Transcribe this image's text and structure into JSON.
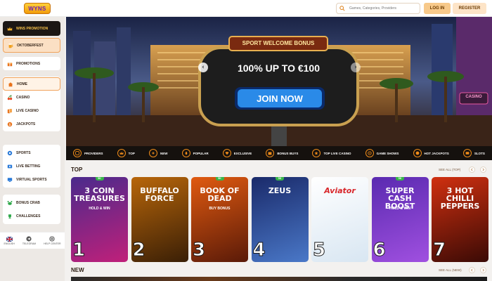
{
  "header": {
    "logo_text": "WYNS",
    "search_placeholder": "Games, Categories, Providers",
    "login_label": "LOG IN",
    "register_label": "REGISTER"
  },
  "sidebar": {
    "promo_items": [
      {
        "label": "Wins Promotion",
        "icon": "crown-icon"
      },
      {
        "label": "Oktoberfest",
        "icon": "beer-icon"
      }
    ],
    "group1": [
      {
        "label": "Promotions",
        "icon": "gift-icon"
      }
    ],
    "group2": [
      {
        "label": "Home",
        "icon": "home-icon",
        "active": true
      },
      {
        "label": "Casino",
        "icon": "cherry-icon"
      },
      {
        "label": "Live Casino",
        "icon": "cards-icon"
      },
      {
        "label": "Jackpots",
        "icon": "jackpot-icon"
      }
    ],
    "group3": [
      {
        "label": "Sports",
        "icon": "ball-icon"
      },
      {
        "label": "Live Betting",
        "icon": "live-icon"
      },
      {
        "label": "Virtual Sports",
        "icon": "monitor-icon"
      }
    ],
    "group4": [
      {
        "label": "Bonus Crab",
        "icon": "crab-icon"
      },
      {
        "label": "Challenges",
        "icon": "trophy-icon"
      }
    ],
    "bottom": [
      {
        "label": "English",
        "icon": "flag-icon"
      },
      {
        "label": "Telegram",
        "icon": "telegram-icon"
      },
      {
        "label": "Help Center",
        "icon": "help-icon"
      }
    ]
  },
  "hero": {
    "sign_title": "SPORT WELCOME BONUS",
    "offer": "100% UP TO €100",
    "cta": "JOIN NOW",
    "casino_sign": "CASINO"
  },
  "categories": [
    {
      "label": "Providers",
      "icon": "providers-icon"
    },
    {
      "label": "Top",
      "icon": "top-icon"
    },
    {
      "label": "New",
      "icon": "new-icon"
    },
    {
      "label": "Popular",
      "icon": "popular-icon"
    },
    {
      "label": "Exclusive",
      "icon": "exclusive-icon"
    },
    {
      "label": "Bonus Buys",
      "icon": "bonus-buys-icon"
    },
    {
      "label": "Top Live Casino",
      "icon": "live-casino-icon"
    },
    {
      "label": "Game Shows",
      "icon": "game-shows-icon"
    },
    {
      "label": "Hot Jackpots",
      "icon": "hot-jackpots-icon"
    },
    {
      "label": "Slots",
      "icon": "slots-icon"
    }
  ],
  "sections": {
    "top": {
      "title": "TOP",
      "see_all": "SEE ALL (TOP)"
    },
    "new": {
      "title": "NEW",
      "see_all": "SEE ALL (NEW)"
    }
  },
  "games": [
    {
      "rank": "1",
      "title": "3 COIN TREASURES",
      "subtitle": "HOLD & WIN",
      "badge": "5K",
      "colors": [
        "#4a2a8c",
        "#c0207a"
      ]
    },
    {
      "rank": "2",
      "title": "BUFFALO FORCE",
      "subtitle": "",
      "badge": "",
      "colors": [
        "#b8660a",
        "#3a1f06"
      ]
    },
    {
      "rank": "3",
      "title": "BOOK OF DEAD",
      "subtitle": "BUY BONUS",
      "badge": "5K",
      "colors": [
        "#e05a10",
        "#5a1a08"
      ]
    },
    {
      "rank": "4",
      "title": "ZEUS",
      "subtitle": "",
      "badge": "5K",
      "colors": [
        "#1a2a6a",
        "#4a78c8"
      ]
    },
    {
      "rank": "5",
      "title": "Aviator",
      "subtitle": "",
      "badge": "",
      "colors": [
        "#ffffff",
        "#d8e6f2"
      ]
    },
    {
      "rank": "6",
      "title": "SUPER CASH BOOST",
      "subtitle": "HOLD & WIN",
      "badge": "5K",
      "colors": [
        "#5a2ab0",
        "#a050e0"
      ]
    },
    {
      "rank": "7",
      "title": "3 HOT CHILLI PEPPERS",
      "subtitle": "",
      "badge": "",
      "colors": [
        "#d03010",
        "#3a0a05"
      ]
    }
  ]
}
